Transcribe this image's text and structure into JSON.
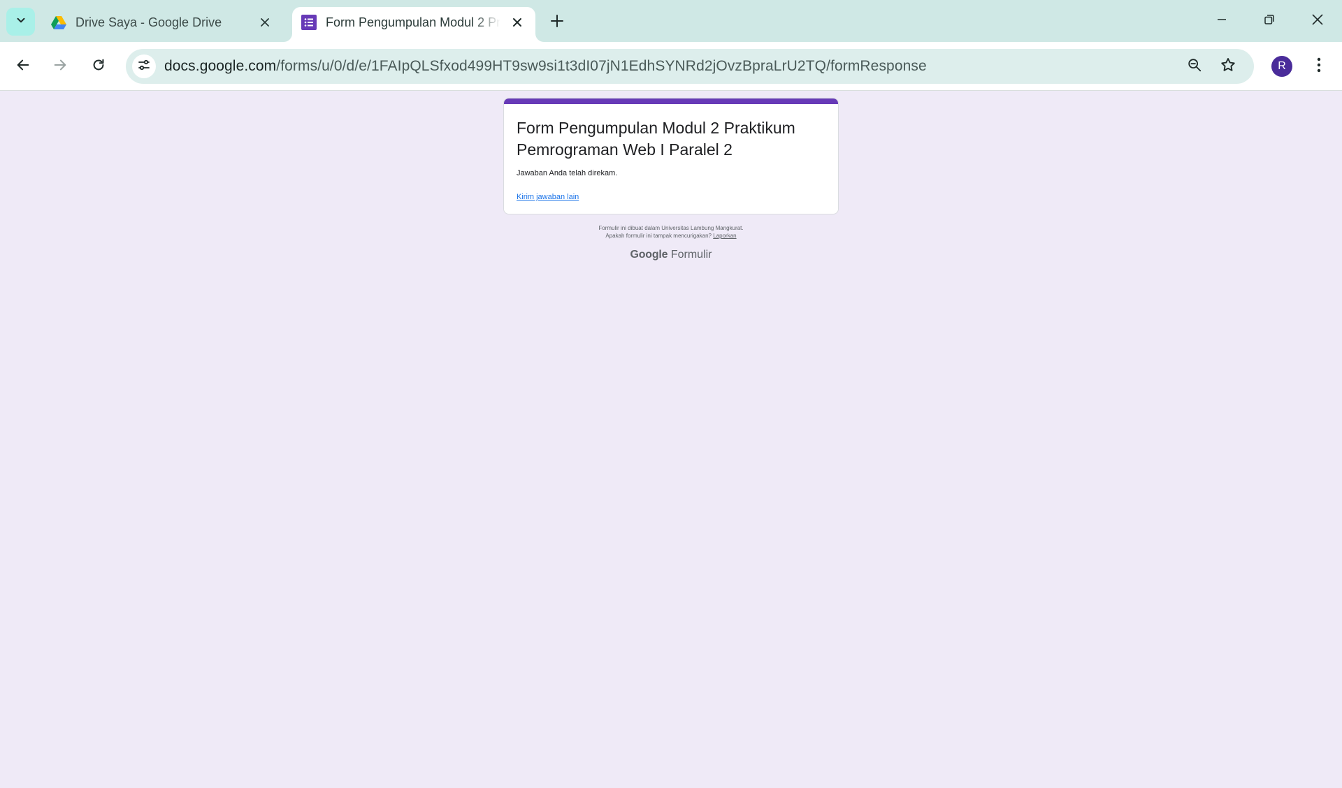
{
  "browser": {
    "tabs": [
      {
        "title": "Drive Saya - Google Drive",
        "active": false,
        "favicon": "google-drive-icon"
      },
      {
        "title": "Form Pengumpulan Modul 2 Praktikum Pemrograman Web I Paralel 2",
        "active": true,
        "favicon": "google-forms-icon"
      }
    ],
    "url": {
      "host": "docs.google.com",
      "path": "/forms/u/0/d/e/1FAIpQLSfxod499HT9sw9si1t3dI07jN1EdhSYNRd2jOvzBpraLrU2TQ/formResponse"
    },
    "profile_initial": "R"
  },
  "form": {
    "title": "Form Pengumpulan Modul 2 Praktikum Pemrograman Web I Paralel 2",
    "confirmation": "Jawaban Anda telah direkam.",
    "another_response_link": "Kirim jawaban lain",
    "accent_color": "#673ab7"
  },
  "footer": {
    "line1": "Formulir ini dibuat dalam Universitas Lambung Mangkurat.",
    "line2": "Apakah formulir ini tampak mencurigakan?",
    "report_link": "Laporkan",
    "brand_google": "Google",
    "brand_product": "Formulir"
  },
  "colors": {
    "tabstrip_bg": "#cfe8e5",
    "omnibox_bg": "#ddeeec",
    "page_bg": "#efeaf7",
    "link": "#1a73e8"
  }
}
